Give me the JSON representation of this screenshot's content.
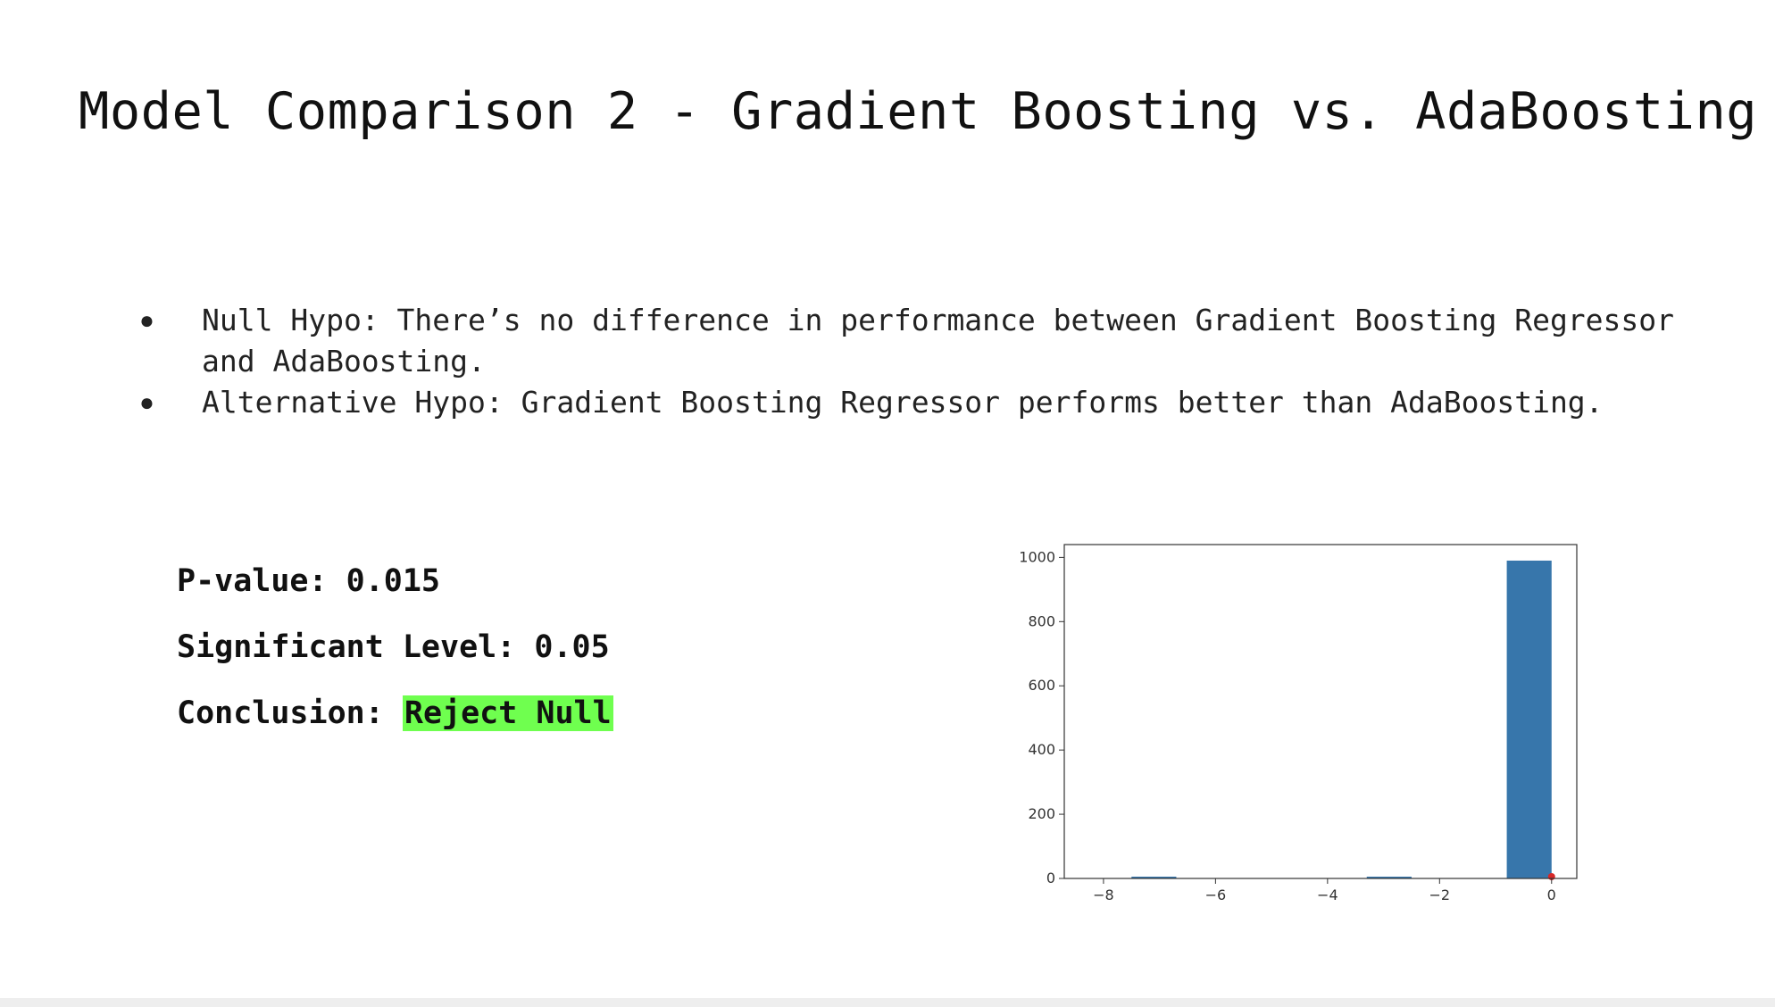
{
  "slide": {
    "title": "Model Comparison 2 - Gradient Boosting vs. AdaBoosting",
    "bullets": [
      {
        "text": "Null Hypo: There’s no difference in performance between Gradient Boosting Regressor and AdaBoosting."
      },
      {
        "text": "Alternative Hypo: Gradient Boosting Regressor performs better than AdaBoosting."
      }
    ],
    "bullet_glyph": "●",
    "stats": {
      "p_value_label": "P-value: 0.015",
      "sig_level_label": "Significant Level: 0.05",
      "conclusion_label": "Conclusion: ",
      "conclusion_value": "Reject Null",
      "highlight_color": "#6fff4f"
    }
  },
  "chart_data": {
    "type": "bar",
    "title": "",
    "xlabel": "",
    "ylabel": "",
    "xlim": [
      -8.7,
      0.45
    ],
    "ylim": [
      0,
      1040
    ],
    "xticks": [
      -8,
      -6,
      -4,
      -2,
      0
    ],
    "yticks": [
      0,
      200,
      400,
      600,
      800,
      1000
    ],
    "bar_color": "#3776ab",
    "marker_color": "#d62728",
    "bins": [
      {
        "x0": -7.5,
        "x1": -6.7,
        "value": 3
      },
      {
        "x0": -3.3,
        "x1": -2.5,
        "value": 3
      },
      {
        "x0": -0.8,
        "x1": 0.0,
        "value": 990
      }
    ],
    "marker": {
      "x": 0.0,
      "y": 0
    },
    "grid": false
  }
}
